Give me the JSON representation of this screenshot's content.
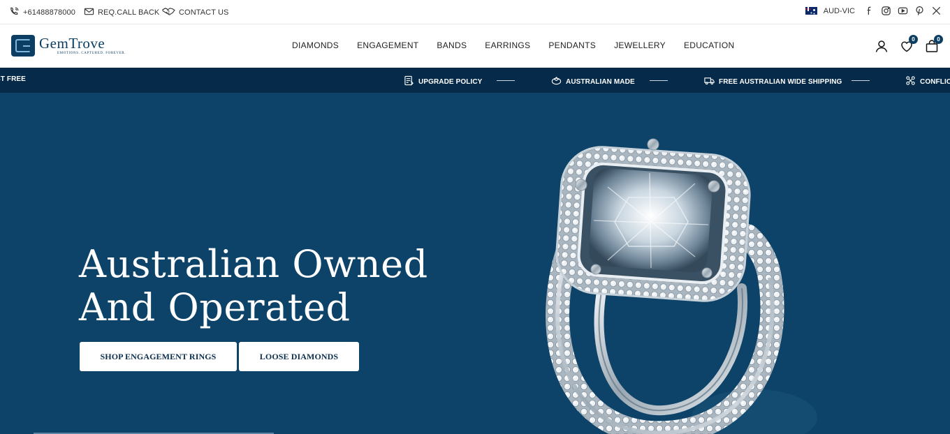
{
  "topbar": {
    "phone": "+61488878000",
    "call_back": "REQ.CALL BACK",
    "contact": "CONTACT US",
    "currency": "AUD-VIC",
    "social": [
      "facebook-icon",
      "instagram-icon",
      "youtube-icon",
      "pinterest-icon",
      "x-icon"
    ]
  },
  "header": {
    "logo_name": "GemTrove",
    "logo_tagline": "EMOTIONS. CAPTURED. FOREVER.",
    "nav": [
      "DIAMONDS",
      "ENGAGEMENT",
      "BANDS",
      "EARRINGS",
      "PENDANTS",
      "JEWELLERY",
      "EDUCATION"
    ],
    "wishlist_count": "0",
    "cart_count": "0"
  },
  "marquee": {
    "items": [
      "ST FREE",
      "UPGRADE POLICY",
      "AUSTRALIAN MADE",
      "FREE AUSTRALIAN WIDE SHIPPING",
      "CONFLIC"
    ]
  },
  "hero": {
    "title_line1": "Australian Owned",
    "title_line2": "And Operated",
    "button_primary": "SHOP ENGAGEMENT RINGS",
    "button_secondary": "LOOSE DIAMONDS"
  },
  "colors": {
    "navy": "#0d4368",
    "strip": "#062a49",
    "brand": "#0b3e62"
  }
}
